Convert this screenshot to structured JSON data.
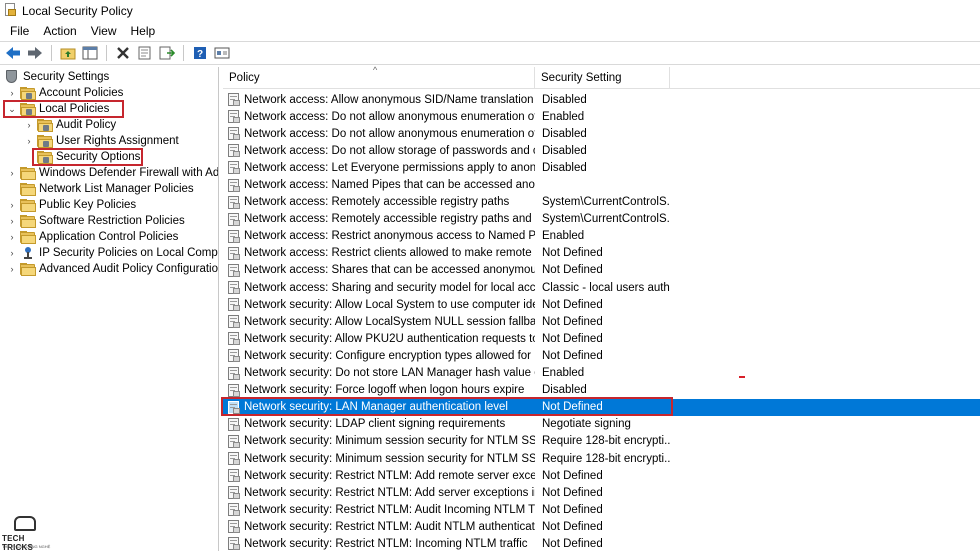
{
  "window": {
    "title": "Local Security Policy"
  },
  "menu": [
    "File",
    "Action",
    "View",
    "Help"
  ],
  "toolbar": {
    "icons": [
      "back-icon",
      "forward-icon",
      "up-folder-icon",
      "show-hide-tree-icon",
      "delete-icon",
      "properties-icon",
      "export-list-icon",
      "help-icon",
      "view-icon"
    ]
  },
  "tree": {
    "root": "Security Settings",
    "items": [
      {
        "label": "Account Policies",
        "level": 1,
        "expander": "collapsed"
      },
      {
        "label": "Local Policies",
        "level": 1,
        "expander": "expanded"
      },
      {
        "label": "Audit Policy",
        "level": 2,
        "expander": "collapsed"
      },
      {
        "label": "User Rights Assignment",
        "level": 2,
        "expander": "collapsed"
      },
      {
        "label": "Security Options",
        "level": 2,
        "expander": "none"
      },
      {
        "label": "Windows Defender Firewall with Adva",
        "level": 1,
        "expander": "collapsed"
      },
      {
        "label": "Network List Manager Policies",
        "level": 1,
        "expander": "none"
      },
      {
        "label": "Public Key Policies",
        "level": 1,
        "expander": "collapsed"
      },
      {
        "label": "Software Restriction Policies",
        "level": 1,
        "expander": "collapsed"
      },
      {
        "label": "Application Control Policies",
        "level": 1,
        "expander": "collapsed"
      },
      {
        "label": "IP Security Policies on Local Compute",
        "level": 1,
        "expander": "collapsed"
      },
      {
        "label": "Advanced Audit Policy Configuration",
        "level": 1,
        "expander": "collapsed"
      }
    ]
  },
  "list": {
    "columns": [
      "Policy",
      "Security Setting"
    ],
    "rows": [
      {
        "policy": "Network access: Allow anonymous SID/Name translation",
        "setting": "Disabled"
      },
      {
        "policy": "Network access: Do not allow anonymous enumeration of S...",
        "setting": "Enabled"
      },
      {
        "policy": "Network access: Do not allow anonymous enumeration of S...",
        "setting": "Disabled"
      },
      {
        "policy": "Network access: Do not allow storage of passwords and cre...",
        "setting": "Disabled"
      },
      {
        "policy": "Network access: Let Everyone permissions apply to anonym...",
        "setting": "Disabled"
      },
      {
        "policy": "Network access: Named Pipes that can be accessed anonym...",
        "setting": ""
      },
      {
        "policy": "Network access: Remotely accessible registry paths",
        "setting": "System\\CurrentControlS..."
      },
      {
        "policy": "Network access: Remotely accessible registry paths and sub...",
        "setting": "System\\CurrentControlS..."
      },
      {
        "policy": "Network access: Restrict anonymous access to Named Pipes...",
        "setting": "Enabled"
      },
      {
        "policy": "Network access: Restrict clients allowed to make remote call...",
        "setting": "Not Defined"
      },
      {
        "policy": "Network access: Shares that can be accessed anonymously",
        "setting": "Not Defined"
      },
      {
        "policy": "Network access: Sharing and security model for local accou...",
        "setting": "Classic - local users auth..."
      },
      {
        "policy": "Network security: Allow Local System to use computer ident...",
        "setting": "Not Defined"
      },
      {
        "policy": "Network security: Allow LocalSystem NULL session fallback",
        "setting": "Not Defined"
      },
      {
        "policy": "Network security: Allow PKU2U authentication requests to t...",
        "setting": "Not Defined"
      },
      {
        "policy": "Network security: Configure encryption types allowed for Ke...",
        "setting": "Not Defined"
      },
      {
        "policy": "Network security: Do not store LAN Manager hash value on ...",
        "setting": "Enabled"
      },
      {
        "policy": "Network security: Force logoff when logon hours expire",
        "setting": "Disabled"
      },
      {
        "policy": "Network security: LAN Manager authentication level",
        "setting": "Not Defined",
        "selected": true
      },
      {
        "policy": "Network security: LDAP client signing requirements",
        "setting": "Negotiate signing"
      },
      {
        "policy": "Network security: Minimum session security for NTLM SSP ...",
        "setting": "Require 128-bit encrypti..."
      },
      {
        "policy": "Network security: Minimum session security for NTLM SSP ...",
        "setting": "Require 128-bit encrypti..."
      },
      {
        "policy": "Network security: Restrict NTLM: Add remote server excepti...",
        "setting": "Not Defined"
      },
      {
        "policy": "Network security: Restrict NTLM: Add server exceptions in t...",
        "setting": "Not Defined"
      },
      {
        "policy": "Network security: Restrict NTLM: Audit Incoming NTLM Tra...",
        "setting": "Not Defined"
      },
      {
        "policy": "Network security: Restrict NTLM: Audit NTLM authenticatio...",
        "setting": "Not Defined"
      },
      {
        "policy": "Network security: Restrict NTLM: Incoming NTLM traffic",
        "setting": "Not Defined"
      }
    ]
  },
  "watermark": {
    "brand": "TECH TRICKS",
    "tagline": "THỦ THUẬT CÔNG NGHỆ"
  },
  "colors": {
    "selection": "#0078d7",
    "highlight_box": "#c6262e"
  }
}
